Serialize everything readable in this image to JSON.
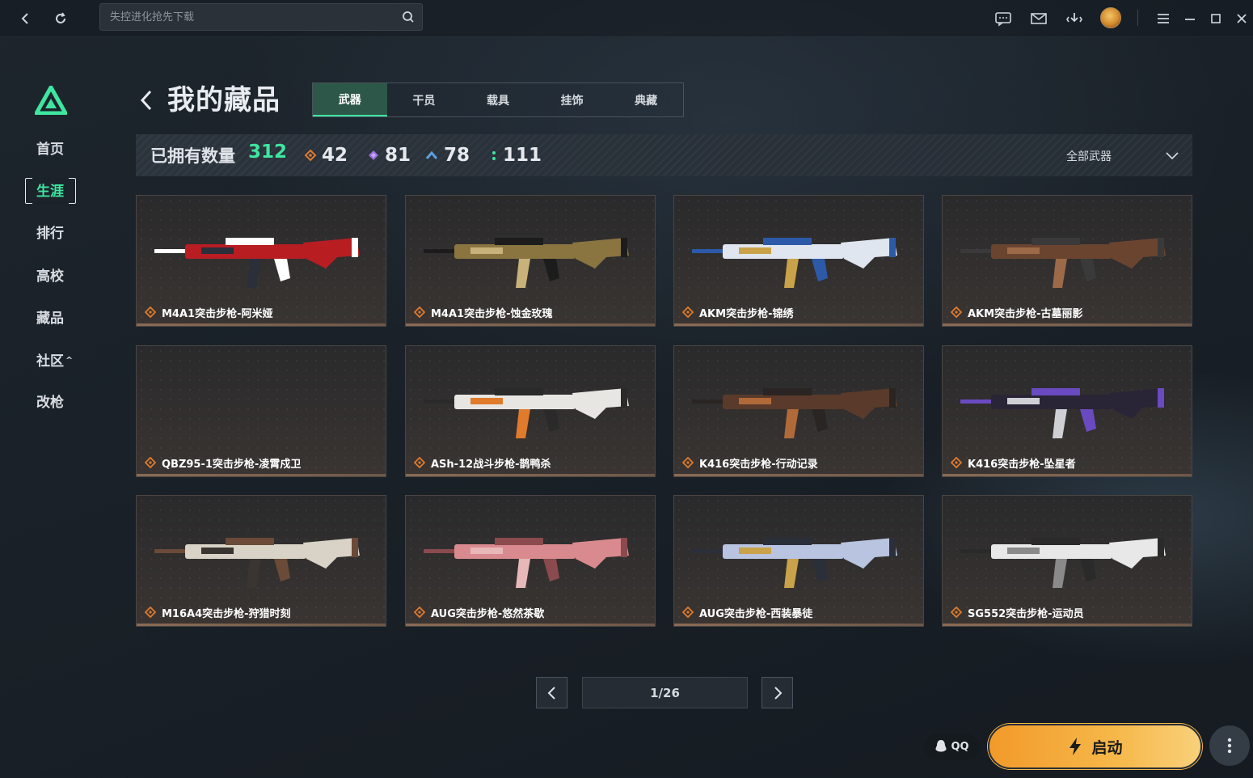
{
  "search": {
    "placeholder": "失控进化抢先下载"
  },
  "sidebar": {
    "items": [
      {
        "label": "首页"
      },
      {
        "label": "生涯"
      },
      {
        "label": "排行"
      },
      {
        "label": "高校"
      },
      {
        "label": "藏品"
      },
      {
        "label": "社区"
      },
      {
        "label": "改枪"
      }
    ]
  },
  "header": {
    "title": "我的藏品",
    "tabs": [
      {
        "label": "武器"
      },
      {
        "label": "干员"
      },
      {
        "label": "载具"
      },
      {
        "label": "挂饰"
      },
      {
        "label": "典藏"
      }
    ]
  },
  "stats": {
    "owned_label": "已拥有数量",
    "owned_count": "312",
    "counts": [
      {
        "icon": "orange-diamond-icon",
        "color": "#e07b2c",
        "value": "42"
      },
      {
        "icon": "purple-diamond-icon",
        "color": "#9a6fe0",
        "value": "81"
      },
      {
        "icon": "blue-chevron-icon",
        "color": "#5aa0e0",
        "value": "78"
      },
      {
        "icon": "green-dots-icon",
        "color": "#3ee6a0",
        "value": "111"
      }
    ],
    "filter_label": "全部武器"
  },
  "items": [
    {
      "name": "M4A1突击步枪-阿米娅",
      "palette": [
        "#b81d22",
        "#ffffff",
        "#2a2f3a"
      ]
    },
    {
      "name": "M4A1突击步枪-蚀金玫瑰",
      "palette": [
        "#8a7440",
        "#1c1c1c",
        "#c9b27a"
      ]
    },
    {
      "name": "AKM突击步枪-锦绣",
      "palette": [
        "#dfe6ef",
        "#2d5aa8",
        "#c9a24a"
      ]
    },
    {
      "name": "AKM突击步枪-古墓丽影",
      "palette": [
        "#6b4430",
        "#3a3a3a",
        "#9c6a48"
      ]
    },
    {
      "name": "QBZ95-1突击步枪-凌霄戍卫",
      "palette": []
    },
    {
      "name": "ASh-12战斗步枪-鹊鸭杀",
      "palette": [
        "#e8e6e2",
        "#2a2a2a",
        "#e07b2c"
      ]
    },
    {
      "name": "K416突击步枪-行动记录",
      "palette": [
        "#5a3a2a",
        "#2a2522",
        "#b06a3a"
      ]
    },
    {
      "name": "K416突击步枪-坠星者",
      "palette": [
        "#2a2536",
        "#6a4ac0",
        "#cfd0d6"
      ]
    },
    {
      "name": "M16A4突击步枪-狩猎时刻",
      "palette": [
        "#d8d3c6",
        "#6b4a38",
        "#3a3530"
      ]
    },
    {
      "name": "AUG突击步枪-悠然茶歇",
      "palette": [
        "#d98a8e",
        "#8a4a4e",
        "#e8b8b8"
      ]
    },
    {
      "name": "AUG突击步枪-西装暴徒",
      "palette": [
        "#b8c4e0",
        "#2a2f3a",
        "#c9a24a"
      ]
    },
    {
      "name": "SG552突击步枪-运动员",
      "palette": [
        "#e8e8e8",
        "#2a2a2a",
        "#8a8a8a"
      ]
    }
  ],
  "pagination": {
    "text": "1/26"
  },
  "bottom": {
    "qq_label": "QQ",
    "launch_label": "启动"
  },
  "colors": {
    "accent": "#3ee6a0",
    "launch": "#f6b84a",
    "rarity": "#e07b2c"
  }
}
